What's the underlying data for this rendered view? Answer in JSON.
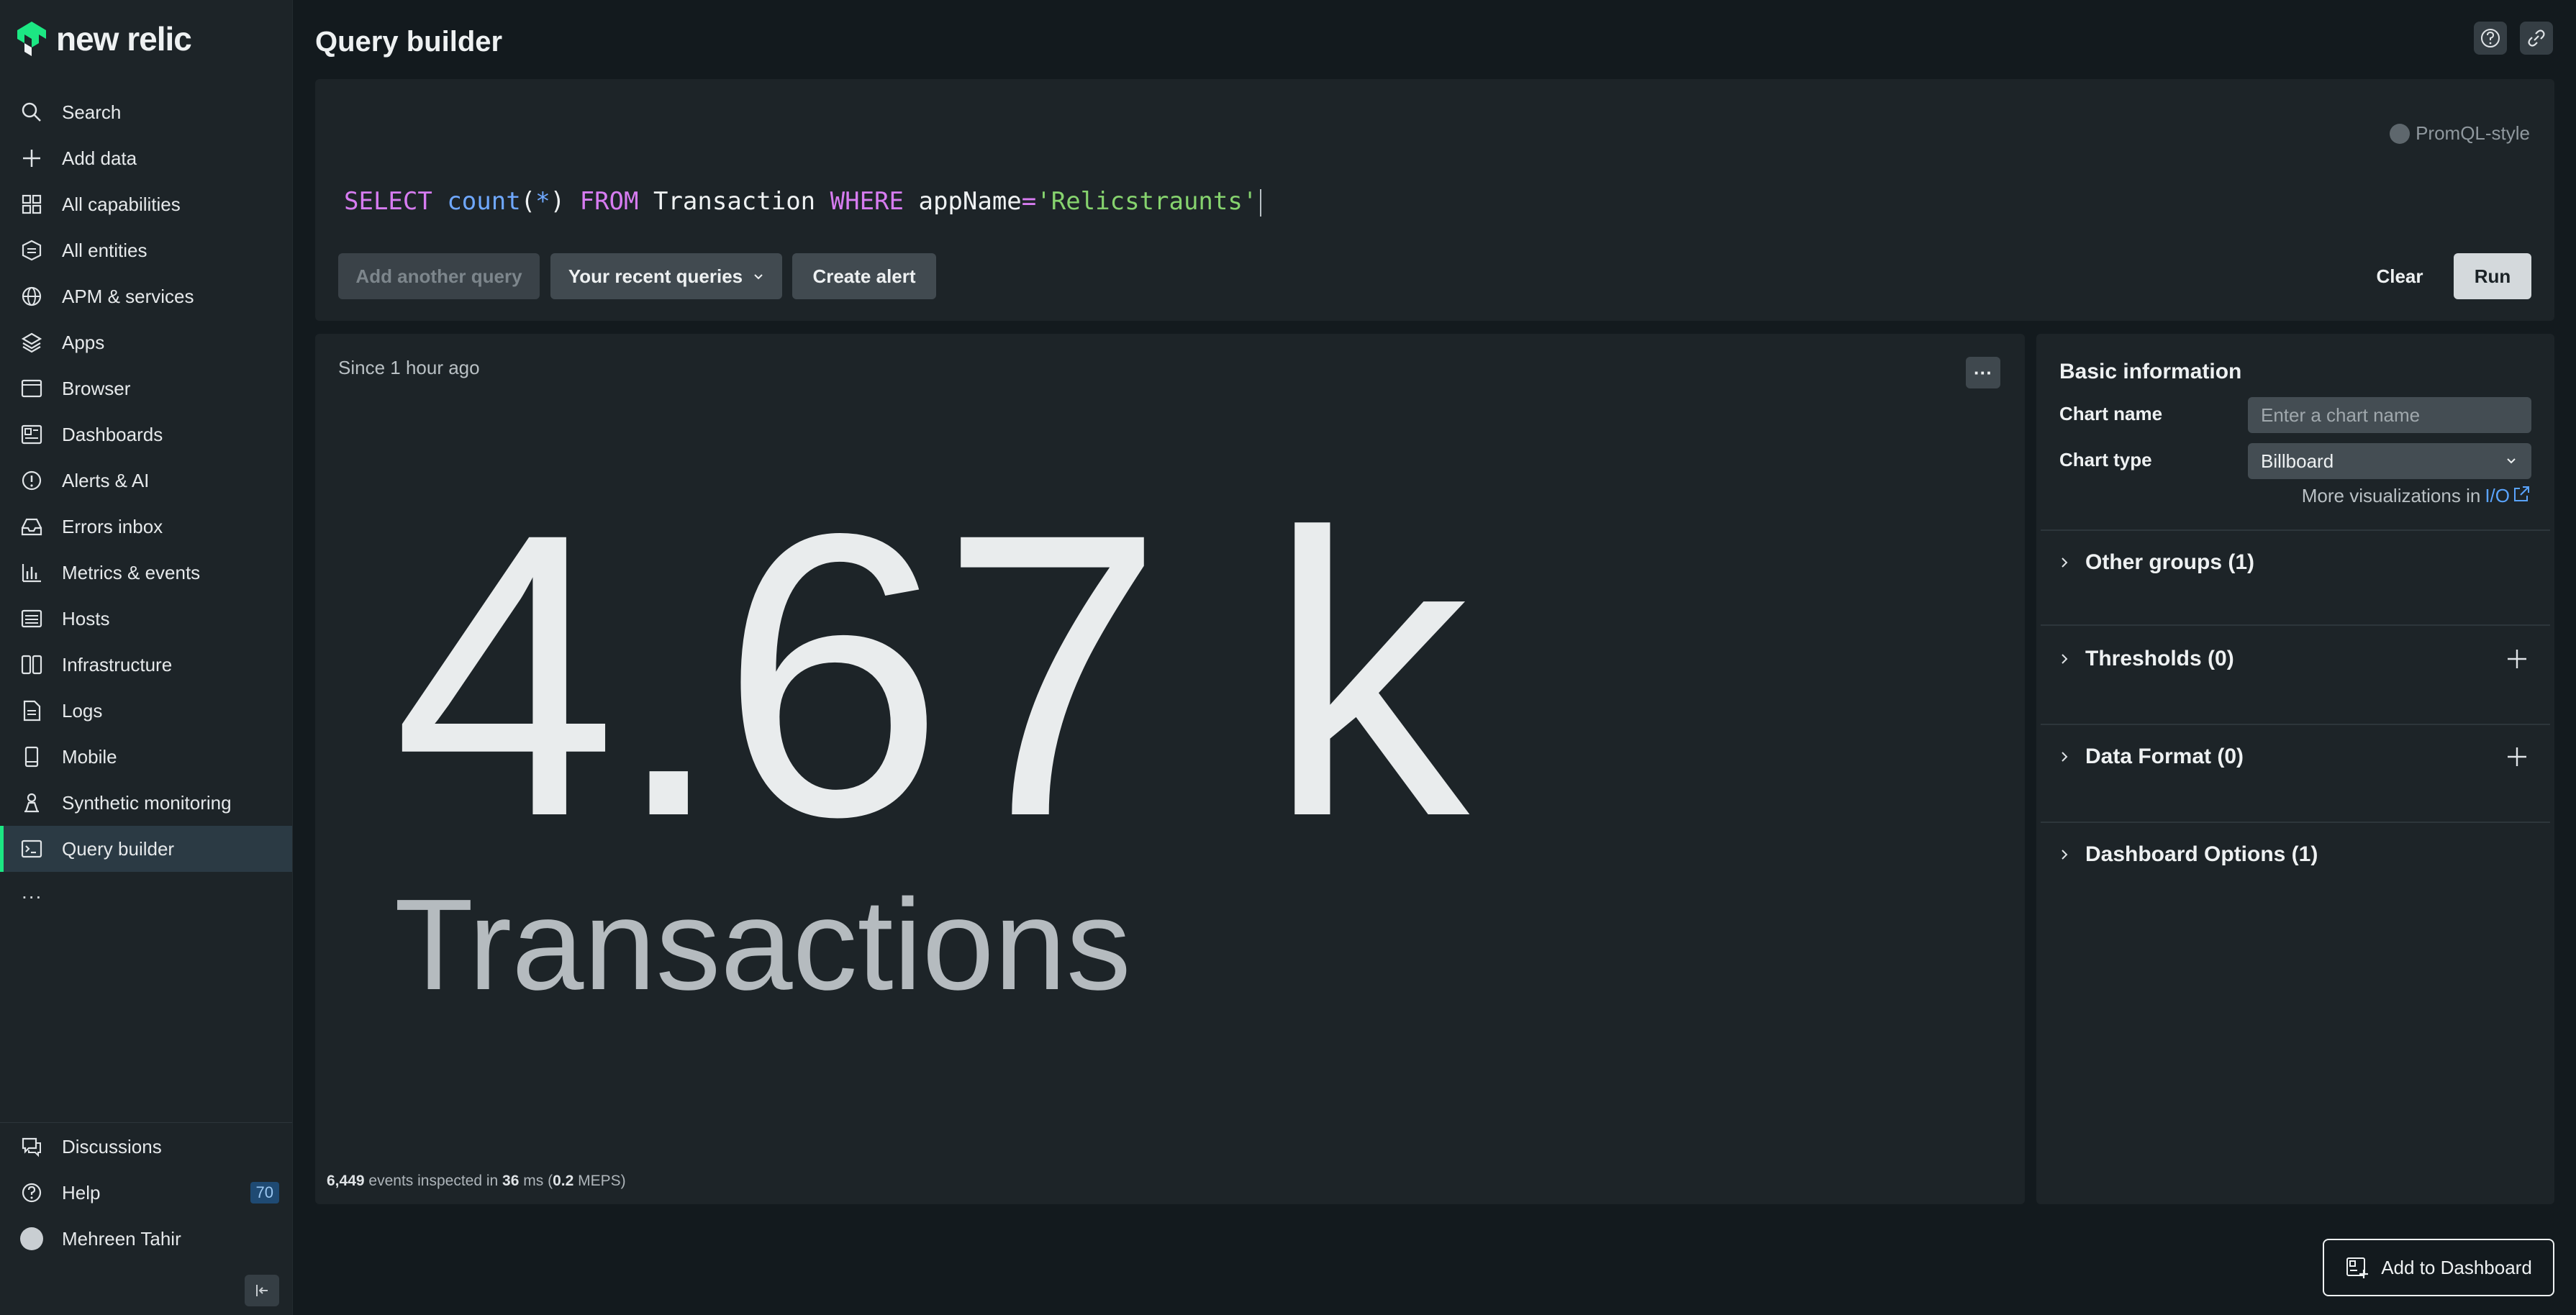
{
  "app": {
    "logo_text": "new relic"
  },
  "sidebar": {
    "items": [
      {
        "label": "Search",
        "icon": "search-icon"
      },
      {
        "label": "Add data",
        "icon": "plus-icon"
      },
      {
        "label": "All capabilities",
        "icon": "grid-icon"
      },
      {
        "label": "All entities",
        "icon": "hexagon-icon"
      },
      {
        "label": "APM & services",
        "icon": "globe-icon"
      },
      {
        "label": "Apps",
        "icon": "layers-icon"
      },
      {
        "label": "Browser",
        "icon": "browser-icon"
      },
      {
        "label": "Dashboards",
        "icon": "dashboard-icon"
      },
      {
        "label": "Alerts & AI",
        "icon": "alert-icon"
      },
      {
        "label": "Errors inbox",
        "icon": "inbox-icon"
      },
      {
        "label": "Metrics & events",
        "icon": "bar-chart-icon"
      },
      {
        "label": "Hosts",
        "icon": "hosts-icon"
      },
      {
        "label": "Infrastructure",
        "icon": "infrastructure-icon"
      },
      {
        "label": "Logs",
        "icon": "logs-icon"
      },
      {
        "label": "Mobile",
        "icon": "mobile-icon"
      },
      {
        "label": "Synthetic monitoring",
        "icon": "synthetic-icon"
      },
      {
        "label": "Query builder",
        "icon": "terminal-icon",
        "active": true
      }
    ],
    "more": "...",
    "bottom": {
      "discussions": "Discussions",
      "help": "Help",
      "help_badge": "70",
      "user": "Mehreen Tahir"
    }
  },
  "header": {
    "title": "Query builder"
  },
  "query": {
    "promql_label": "PromQL-style",
    "tokens": {
      "select": "SELECT",
      "fn": "count",
      "open": "(",
      "arg": "*",
      "close": ")",
      "from": "FROM",
      "table": "Transaction",
      "where": "WHERE",
      "field": "appName",
      "eq": "=",
      "value": "'Relicstraunts'"
    },
    "buttons": {
      "add_another": "Add another query",
      "recent": "Your recent queries",
      "create_alert": "Create alert",
      "clear": "Clear",
      "run": "Run"
    }
  },
  "result": {
    "since": "Since 1 hour ago",
    "menu": "···",
    "value": "4.67 k",
    "label": "Transactions",
    "events_count": "6,449",
    "events_text": "events inspected in",
    "duration": "36",
    "duration_unit": "ms (",
    "meps": "0.2",
    "meps_unit": "MEPS)"
  },
  "settings": {
    "title": "Basic information",
    "chart_name_label": "Chart name",
    "chart_name_placeholder": "Enter a chart name",
    "chart_type_label": "Chart type",
    "chart_type_value": "Billboard",
    "more_vis_text": "More visualizations in",
    "more_vis_link": "I/O",
    "sections": [
      {
        "label": "Other groups (1)"
      },
      {
        "label": "Thresholds (0)"
      },
      {
        "label": "Data Format (0)"
      },
      {
        "label": "Dashboard Options (1)"
      }
    ]
  },
  "actions": {
    "add_to_dashboard": "Add to Dashboard"
  },
  "colors": {
    "accent": "#1ce783",
    "link": "#5aa4ff",
    "keyword": "#d77cf1",
    "function": "#6fa8ff",
    "string": "#86d36e"
  }
}
